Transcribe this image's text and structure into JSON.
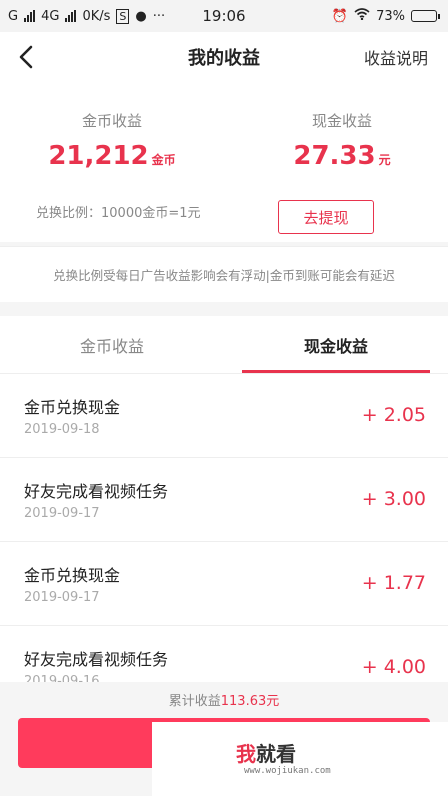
{
  "status_bar": {
    "carrier1": "G",
    "carrier2": "4G",
    "speed": "0K/s",
    "time": "19:06",
    "battery_percent": "73%",
    "battery_level": 0.73,
    "dots": "···"
  },
  "nav": {
    "title": "我的收益",
    "help_label": "收益说明"
  },
  "summary": {
    "coin_label": "金币收益",
    "coin_value": "21,212",
    "coin_unit": "金币",
    "cash_label": "现金收益",
    "cash_value": "27.33",
    "cash_unit": "元",
    "ratio_text": "兑换比例：10000金币=1元",
    "withdraw_label": "去提现"
  },
  "notice": "兑换比例受每日广告收益影响会有浮动|金币到账可能会有延迟",
  "tabs": [
    {
      "label": "金币收益",
      "active": false
    },
    {
      "label": "现金收益",
      "active": true
    }
  ],
  "records": [
    {
      "name": "金币兑换现金",
      "date": "2019-09-18",
      "amount": "+ 2.05"
    },
    {
      "name": "好友完成看视频任务",
      "date": "2019-09-17",
      "amount": "+ 3.00"
    },
    {
      "name": "金币兑换现金",
      "date": "2019-09-17",
      "amount": "+ 1.77"
    },
    {
      "name": "好友完成看视频任务",
      "date": "2019-09-16",
      "amount": "+ 4.00"
    }
  ],
  "footer": {
    "total_label": "累计收益",
    "total_value": "113.63元"
  },
  "watermark": {
    "char1": "我",
    "rest": "就看",
    "url": "www.wojiukan.com"
  },
  "colors": {
    "accent": "#e8334d",
    "button": "#ff3b5c"
  }
}
